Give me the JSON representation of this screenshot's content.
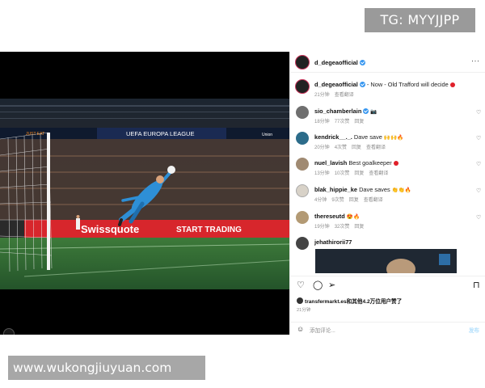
{
  "watermark_top": "TG: MYYJJPP",
  "watermark_bottom": "www.wukongjiuyuan.com",
  "photo": {
    "banner_text": "UEFA EUROPA LEAGUE",
    "ad_left": "Swissquote",
    "ad_right": "START TRADING",
    "small_left": "JUST EAT",
    "small_right": "Union"
  },
  "header": {
    "username": "d_degeaofficial",
    "more": "···"
  },
  "caption": {
    "username": "d_degeaofficial",
    "text": "Now - Old Trafford will decide",
    "time": "21分钟",
    "translate": "查看翻译"
  },
  "comments": [
    {
      "user": "sio_chamberlain",
      "text": "",
      "emoji": "📷",
      "time": "18分钟",
      "likes": "77次赞",
      "reply": "回复",
      "translate": ""
    },
    {
      "user": "kendrick__._.",
      "text": "Dave save",
      "emoji": "🙌🙌🔥",
      "time": "20分钟",
      "likes": "4次赞",
      "reply": "回复",
      "translate": "查看翻译"
    },
    {
      "user": "nuel_lavish",
      "text": "Best goalkeeper",
      "emoji": "❤️",
      "time": "13分钟",
      "likes": "10次赞",
      "reply": "回复",
      "translate": "查看翻译"
    },
    {
      "user": "blak_hippie_ke",
      "text": "Dave saves",
      "emoji": "👏👏🔥",
      "time": "4分钟",
      "likes": "9次赞",
      "reply": "回复",
      "translate": "查看翻译"
    },
    {
      "user": "thereseutd",
      "text": "",
      "emoji": "😍🔥",
      "time": "19分钟",
      "likes": "32次赞",
      "reply": "回复",
      "translate": ""
    },
    {
      "user": "jehathirorii77",
      "text": "",
      "emoji": "",
      "time": "",
      "likes": "",
      "reply": "",
      "translate": ""
    }
  ],
  "likes_text": "transfermarkt.es和其他4.2万位用户赞了",
  "post_time": "21分钟",
  "add_comment_placeholder": "添加评论...",
  "post_button": "发布",
  "colors": {
    "verified": "#3897f0",
    "red": "#e0202a",
    "ad_red": "#d7262c",
    "pitch": "#2f6d33"
  }
}
